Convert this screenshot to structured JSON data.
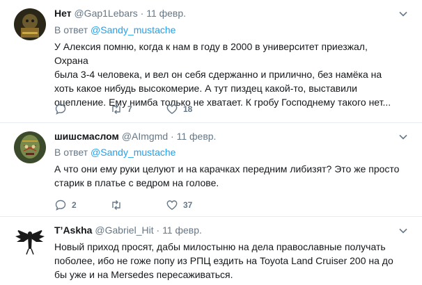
{
  "tweets": [
    {
      "name": "Нет",
      "handle": "@Gap1Lebars",
      "separator": "·",
      "date": "11 февр.",
      "reply_prefix": "В ответ",
      "reply_to": "@Sandy_mustache",
      "lines": [
        "У Алексия помню, когда к нам в году в 2000 в университет приезжал, Охрана",
        "была 3-4 человека, и вел он себя  сдержанно и прилично, без намёка на",
        "хоть какое нибудь высокомерие. А тут пиздец какой-то, выставили",
        "оцепление. Ему нимба только не хватает. К гробу Господнему такого нет..."
      ],
      "retweets": "7",
      "likes": "18"
    },
    {
      "name": "шишсмаслом",
      "handle": "@AImgmd",
      "separator": "·",
      "date": "11 февр.",
      "reply_prefix": "В ответ",
      "reply_to": "@Sandy_mustache",
      "lines": [
        "А что они ему руки целуют и на карачках передним либизят? Это же просто",
        "старик в платье с ведром на голове."
      ],
      "replies": "2",
      "likes": "37"
    },
    {
      "name": "T’Askha",
      "handle": "@Gabriel_Hit",
      "separator": "·",
      "date": "11 февр.",
      "lines": [
        "Новый приход просят, дабы милостыню на дела православные получать",
        "поболее, ибо не гоже попу из РПЦ ездить на Toyota Land Cruiser 200 на до",
        "бы уже и на Mersedes пересаживаться."
      ]
    }
  ],
  "colors": {
    "link": "#1da1f2",
    "muted": "#657786",
    "text": "#14171a",
    "border": "#e6ecf0"
  },
  "icons": [
    "reply-icon",
    "retweet-icon",
    "like-icon",
    "chevron-down-icon"
  ]
}
